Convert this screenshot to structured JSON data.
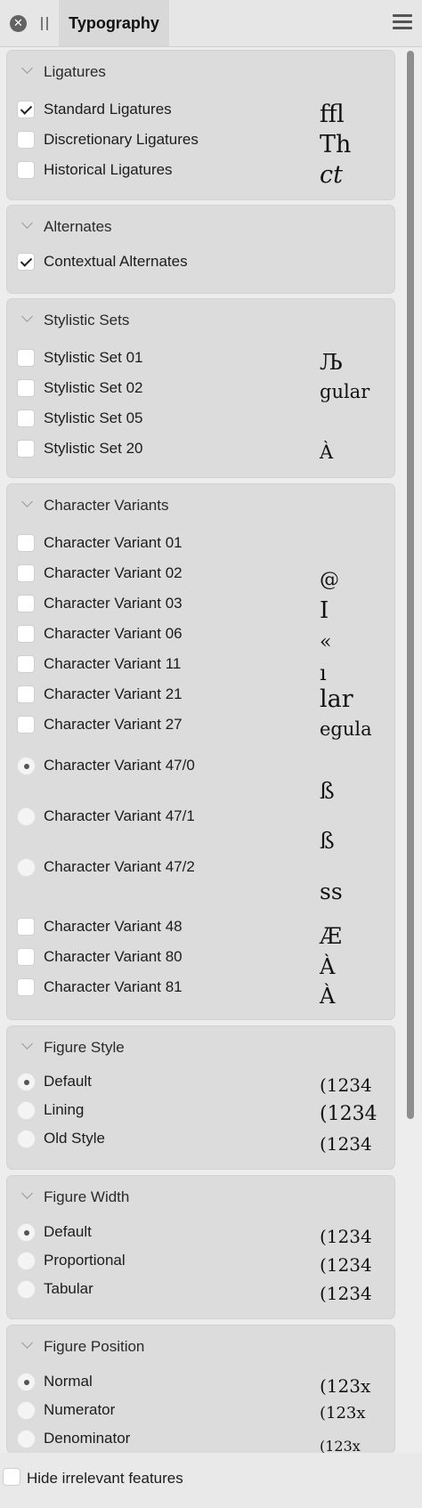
{
  "header": {
    "close_icon": "close-icon",
    "tab_label": "Typography",
    "menu_icon": "hamburger-menu-icon"
  },
  "sections": {
    "ligatures": {
      "title": "Ligatures",
      "items": [
        {
          "label": "Standard Ligatures",
          "checked": true
        },
        {
          "label": "Discretionary Ligatures",
          "checked": false
        },
        {
          "label": "Historical Ligatures",
          "checked": false
        }
      ],
      "samples": [
        "ffl",
        "Th",
        "ct"
      ]
    },
    "alternates": {
      "title": "Alternates",
      "items": [
        {
          "label": "Contextual Alternates",
          "checked": true
        }
      ]
    },
    "stylistic_sets": {
      "title": "Stylistic Sets",
      "items": [
        {
          "label": "Stylistic Set 01",
          "checked": false
        },
        {
          "label": "Stylistic Set 02",
          "checked": false
        },
        {
          "label": "Stylistic Set 05",
          "checked": false
        },
        {
          "label": "Stylistic Set 20",
          "checked": false
        }
      ],
      "samples": [
        "Љ",
        "gular",
        "À"
      ]
    },
    "character_variants": {
      "title": "Character Variants",
      "checkbox_items": [
        {
          "label": "Character Variant 01",
          "checked": false
        },
        {
          "label": "Character Variant 02",
          "checked": false
        },
        {
          "label": "Character Variant 03",
          "checked": false
        },
        {
          "label": "Character Variant 06",
          "checked": false
        },
        {
          "label": "Character Variant 11",
          "checked": false
        },
        {
          "label": "Character Variant 21",
          "checked": false
        },
        {
          "label": "Character Variant 27",
          "checked": false
        }
      ],
      "radio_items": [
        {
          "label": "Character Variant 47/0",
          "selected": true
        },
        {
          "label": "Character Variant 47/1",
          "selected": false
        },
        {
          "label": "Character Variant 47/2",
          "selected": false
        }
      ],
      "checkbox_items_2": [
        {
          "label": "Character Variant 48",
          "checked": false
        },
        {
          "label": "Character Variant 80",
          "checked": false
        },
        {
          "label": "Character Variant 81",
          "checked": false
        }
      ],
      "samples": [
        "@",
        "I",
        "«",
        "ı",
        "lar",
        "egula",
        "ß",
        "ß",
        "ss",
        "Æ",
        "À",
        "À"
      ]
    },
    "figure_style": {
      "title": "Figure Style",
      "items": [
        {
          "label": "Default",
          "selected": true,
          "sample": "(1234"
        },
        {
          "label": "Lining",
          "selected": false,
          "sample": "(1234"
        },
        {
          "label": "Old Style",
          "selected": false,
          "sample": "(1234"
        }
      ]
    },
    "figure_width": {
      "title": "Figure Width",
      "items": [
        {
          "label": "Default",
          "selected": true,
          "sample": "(1234"
        },
        {
          "label": "Proportional",
          "selected": false,
          "sample": "(1234"
        },
        {
          "label": "Tabular",
          "selected": false,
          "sample": "(1234"
        }
      ]
    },
    "figure_position": {
      "title": "Figure Position",
      "items": [
        {
          "label": "Normal",
          "selected": true,
          "sample": "(123x"
        },
        {
          "label": "Numerator",
          "selected": false,
          "sample": "(123x"
        },
        {
          "label": "Denominator",
          "selected": false,
          "sample": "(123x"
        }
      ]
    }
  },
  "footer": {
    "hide_label": "Hide irrelevant features",
    "checked": false
  }
}
